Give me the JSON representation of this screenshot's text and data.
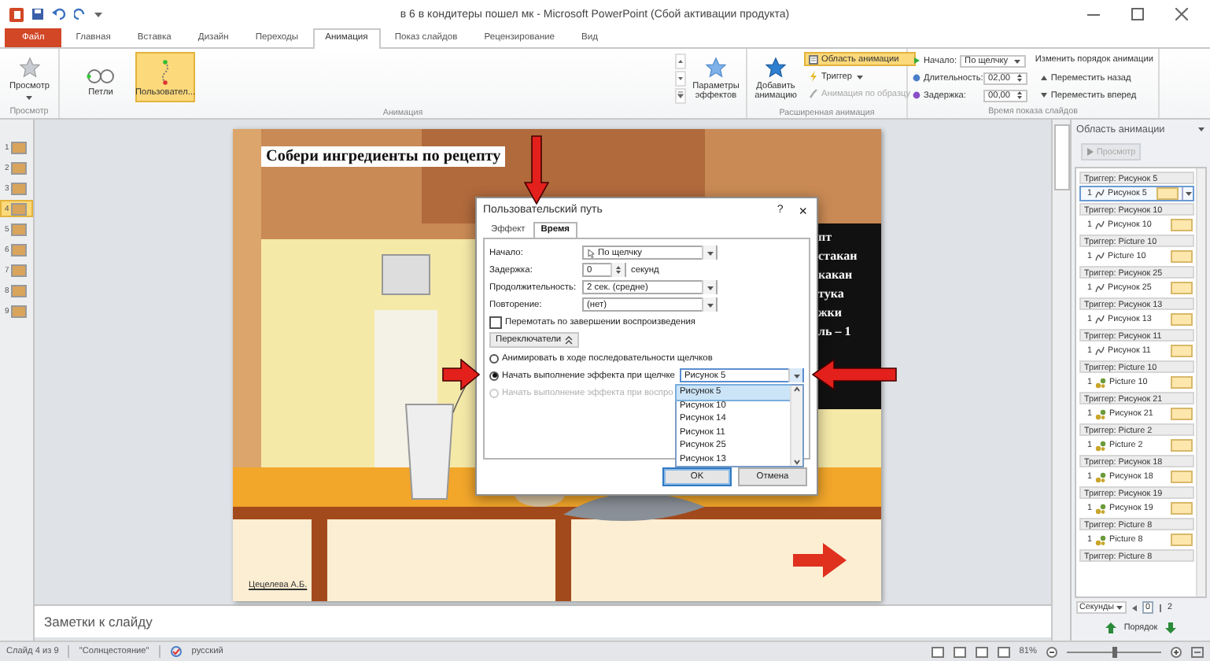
{
  "window": {
    "title": "в 6 в кондитеры пошел мк - Microsoft PowerPoint (Сбой активации продукта)"
  },
  "tabs": [
    {
      "label": "Файл",
      "kind": "file",
      "selected": false
    },
    {
      "label": "Главная",
      "kind": "tab",
      "selected": false
    },
    {
      "label": "Вставка",
      "kind": "tab",
      "selected": false
    },
    {
      "label": "Дизайн",
      "kind": "tab",
      "selected": false
    },
    {
      "label": "Переходы",
      "kind": "tab",
      "selected": false
    },
    {
      "label": "Анимация",
      "kind": "tab",
      "selected": true
    },
    {
      "label": "Показ слайдов",
      "kind": "tab",
      "selected": false
    },
    {
      "label": "Рецензирование",
      "kind": "tab",
      "selected": false
    },
    {
      "label": "Вид",
      "kind": "tab",
      "selected": false
    }
  ],
  "ribbon": {
    "preview": {
      "label": "Просмотр",
      "group": "Просмотр"
    },
    "animation": {
      "group": "Анимация",
      "effect_options": "Параметры эффектов",
      "items": [
        {
          "label": "Петли",
          "kind": "loops",
          "selected": false
        },
        {
          "label": "Пользовател...",
          "kind": "custom",
          "selected": true
        }
      ]
    },
    "advanced": {
      "group": "Расширенная анимация",
      "add_animation": "Добавить анимацию",
      "pane_toggle": {
        "label": "Область анимации",
        "on": true
      },
      "trigger": "Триггер",
      "painter": {
        "label": "Анимация по образцу",
        "disabled": true
      }
    },
    "timing": {
      "group": "Время показа слайдов",
      "start_label": "Начало:",
      "start": "По щелчку",
      "duration_label": "Длительность:",
      "duration": "02,00",
      "delay_label": "Задержка:",
      "delay": "00,00",
      "reorder_title": "Изменить порядок анимации",
      "move_back": "Переместить назад",
      "move_forward": "Переместить вперед"
    }
  },
  "slides": [
    {
      "number": "1",
      "selected": false
    },
    {
      "number": "2",
      "selected": false
    },
    {
      "number": "3",
      "selected": false
    },
    {
      "number": "4",
      "selected": true
    },
    {
      "number": "5",
      "selected": false
    },
    {
      "number": "6",
      "selected": false
    },
    {
      "number": "7",
      "selected": false
    },
    {
      "number": "8",
      "selected": false
    },
    {
      "number": "9",
      "selected": false
    }
  ],
  "slide": {
    "title": "Собери ингредиенты по рецепту",
    "recipe_lines": [
      "пт",
      "стакан",
      "какан",
      "тука",
      "жки",
      "ль – 1"
    ],
    "author": "Цецелева А.Б."
  },
  "notes": {
    "placeholder": "Заметки к слайду"
  },
  "dialog": {
    "title": "Пользовательский путь",
    "help": "?",
    "close": "×",
    "tabs": [
      {
        "label": "Эффект",
        "selected": false
      },
      {
        "label": "Время",
        "selected": true
      }
    ],
    "fields": [
      {
        "label": "Начало:",
        "kind": "click-dropdown",
        "value": "По щелчку"
      },
      {
        "label": "Задержка:",
        "kind": "spinner",
        "value": "0",
        "unit": "секунд"
      },
      {
        "label": "Продолжительность:",
        "kind": "dropdown",
        "value": "2 сек. (средне)"
      },
      {
        "label": "Повторение:",
        "kind": "dropdown",
        "value": "(нет)"
      }
    ],
    "rewind": {
      "label": "Перемотать по завершении воспроизведения",
      "checked": false
    },
    "triggers_button": {
      "label": "Переключатели",
      "expanded": true
    },
    "radios": [
      {
        "label": "Анимировать в ходе последовательности щелчков",
        "selected": false,
        "disabled": false
      },
      {
        "label": "Начать выполнение эффекта при щелчке",
        "selected": true,
        "disabled": false
      },
      {
        "label": "Начать выполнение эффекта при воспро",
        "selected": false,
        "disabled": true
      }
    ],
    "trigger_select": {
      "value": "Рисунок 5",
      "expanded": true,
      "options": [
        {
          "label": "Рисунок 5",
          "selected": true
        },
        {
          "label": "Рисунок 10",
          "selected": false
        },
        {
          "label": "Рисунок 14",
          "selected": false
        },
        {
          "label": "Рисунок 11",
          "selected": false
        },
        {
          "label": "Рисунок 25",
          "selected": false
        },
        {
          "label": "Рисунок 13",
          "selected": false
        }
      ]
    },
    "buttons": [
      {
        "label": "OK",
        "default": true
      },
      {
        "label": "Отмена",
        "default": false
      }
    ]
  },
  "animation_pane": {
    "title": "Область анимации",
    "play": {
      "label": "Просмотр",
      "disabled": true
    },
    "groups": [
      {
        "trigger": "Триггер: Рисунок 5",
        "item": {
          "number": "1",
          "label": "Рисунок 5",
          "kind": "path",
          "selected": true
        }
      },
      {
        "trigger": "Триггер: Рисунок 10",
        "item": {
          "number": "1",
          "label": "Рисунок 10",
          "kind": "path",
          "selected": false
        }
      },
      {
        "trigger": "Триггер: Picture 10",
        "item": {
          "number": "1",
          "label": "Picture 10",
          "kind": "path",
          "selected": false
        }
      },
      {
        "trigger": "Триггер: Рисунок 25",
        "item": {
          "number": "1",
          "label": "Рисунок 25",
          "kind": "path",
          "selected": false
        }
      },
      {
        "trigger": "Триггер: Рисунок 13",
        "item": {
          "number": "1",
          "label": "Рисунок 13",
          "kind": "path",
          "selected": false
        }
      },
      {
        "trigger": "Триггер: Рисунок 11",
        "item": {
          "number": "1",
          "label": "Рисунок 11",
          "kind": "path",
          "selected": false
        }
      },
      {
        "trigger": "Триггер: Picture 10",
        "item": {
          "number": "1",
          "label": "Picture 10",
          "kind": "emphasis",
          "selected": false
        }
      },
      {
        "trigger": "Триггер: Рисунок 21",
        "item": {
          "number": "1",
          "label": "Рисунок 21",
          "kind": "emphasis",
          "selected": false
        }
      },
      {
        "trigger": "Триггер: Picture 2",
        "item": {
          "number": "1",
          "label": "Picture 2",
          "kind": "emphasis",
          "selected": false
        }
      },
      {
        "trigger": "Триггер: Рисунок 18",
        "item": {
          "number": "1",
          "label": "Рисунок 18",
          "kind": "emphasis",
          "selected": false
        }
      },
      {
        "trigger": "Триггер: Рисунок 19",
        "item": {
          "number": "1",
          "label": "Рисунок 19",
          "kind": "emphasis",
          "selected": false
        }
      },
      {
        "trigger": "Триггер: Picture 8",
        "item": {
          "number": "1",
          "label": "Picture 8",
          "kind": "emphasis",
          "selected": false
        }
      },
      {
        "trigger": "Триггер: Picture 8"
      }
    ],
    "timeline": {
      "unit": "Секунды",
      "ticks": [
        "0",
        "2"
      ]
    },
    "reorder": "Порядок"
  },
  "status_bar": {
    "slide": "Слайд 4 из 9",
    "theme": "\"Солнцестояние\"",
    "language": "русский",
    "zoom": "81%",
    "zoom_level": {
      "level": 0.5
    }
  },
  "annotation_arrows": [
    {
      "kind": "down"
    },
    {
      "kind": "right"
    },
    {
      "kind": "left"
    }
  ]
}
